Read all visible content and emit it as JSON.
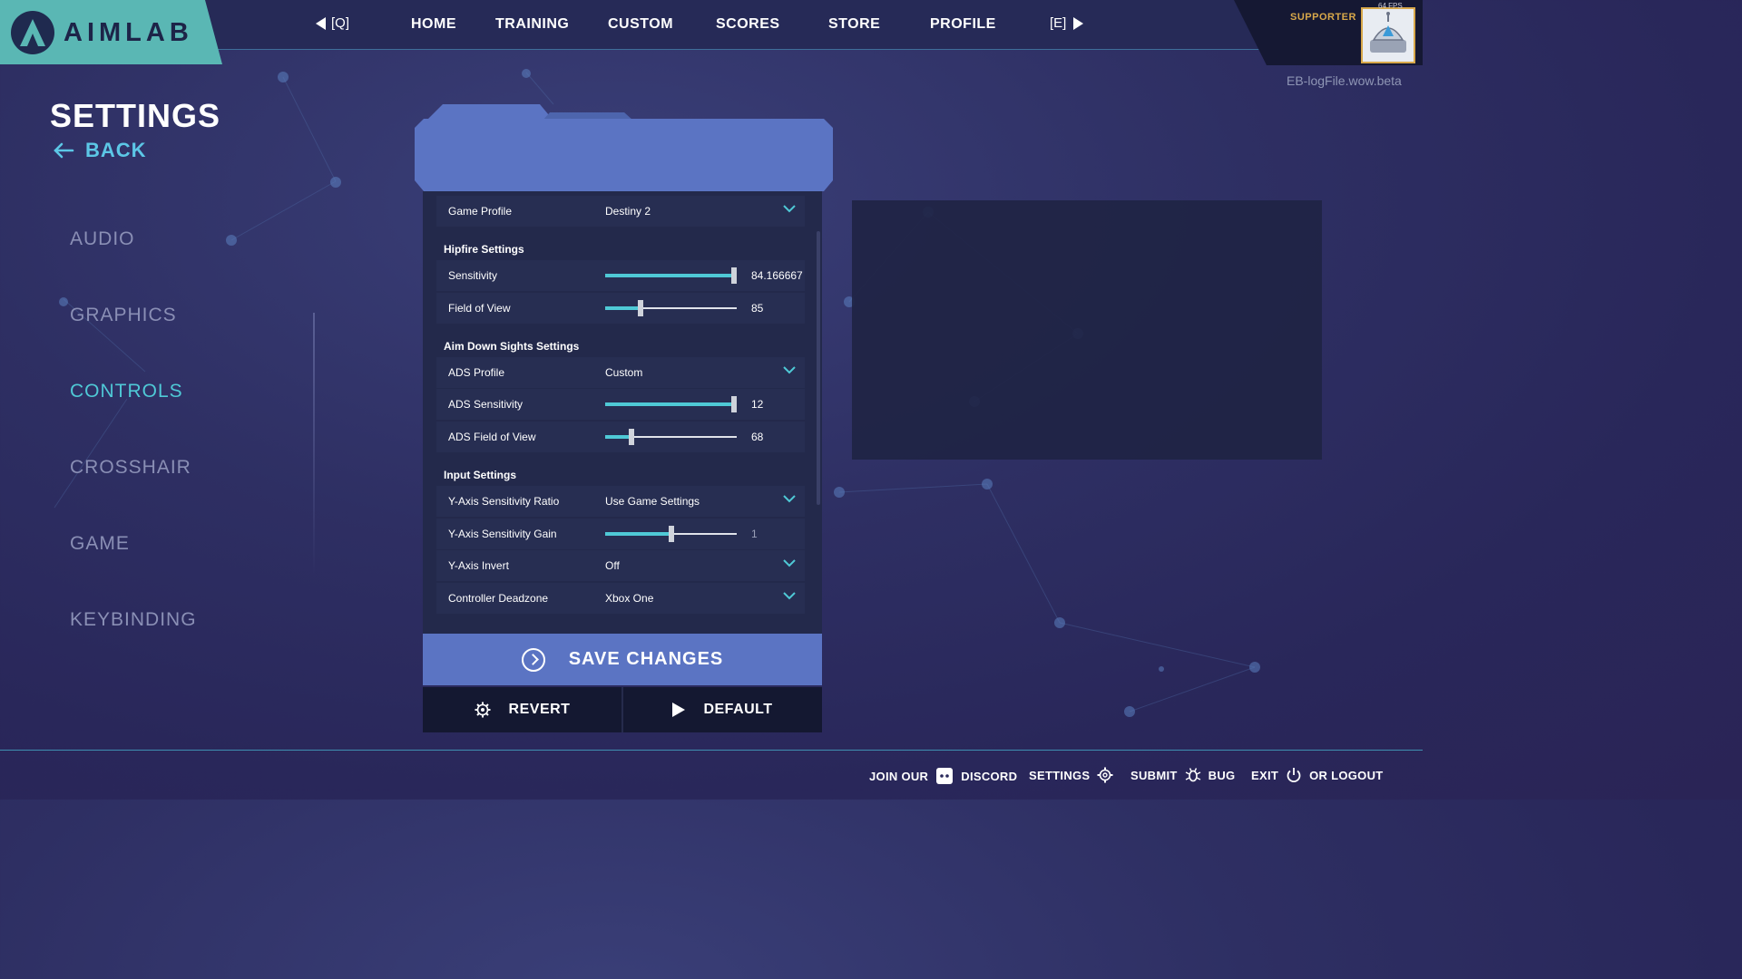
{
  "app": {
    "brand": "AIMLAB"
  },
  "topnav": {
    "prev_key": "[Q]",
    "next_key": "[E]",
    "items": [
      "HOME",
      "TRAINING",
      "CUSTOM",
      "SCORES",
      "STORE",
      "PROFILE"
    ]
  },
  "account": {
    "badge": "SUPPORTER",
    "fps": "64 FPS",
    "log_file": "EB-logFile.wow.beta"
  },
  "settings": {
    "title": "SETTINGS",
    "back": "BACK",
    "categories": [
      "AUDIO",
      "GRAPHICS",
      "CONTROLS",
      "CROSSHAIR",
      "GAME",
      "KEYBINDING"
    ],
    "active_category": "CONTROLS"
  },
  "panel": {
    "game_profile": {
      "label": "Game Profile",
      "value": "Destiny 2"
    },
    "hipfire": {
      "title": "Hipfire Settings",
      "sensitivity": {
        "label": "Sensitivity",
        "value": "84.166667",
        "fraction": 0.98
      },
      "fov": {
        "label": "Field of View",
        "value": "85",
        "fraction": 0.27
      }
    },
    "ads": {
      "title": "Aim Down Sights Settings",
      "profile": {
        "label": "ADS Profile",
        "value": "Custom"
      },
      "sensitivity": {
        "label": "ADS Sensitivity",
        "value": "12",
        "fraction": 0.98
      },
      "fov": {
        "label": "ADS Field of View",
        "value": "68",
        "fraction": 0.2
      }
    },
    "input": {
      "title": "Input Settings",
      "y_ratio": {
        "label": "Y-Axis Sensitivity Ratio",
        "value": "Use Game Settings"
      },
      "y_gain": {
        "label": "Y-Axis Sensitivity Gain",
        "value": "1",
        "fraction": 0.5
      },
      "y_invert": {
        "label": "Y-Axis Invert",
        "value": "Off"
      },
      "deadzone": {
        "label": "Controller Deadzone",
        "value": "Xbox One"
      }
    }
  },
  "actions": {
    "save": "SAVE CHANGES",
    "revert": "REVERT",
    "default": "DEFAULT"
  },
  "footer": {
    "join": "JOIN OUR",
    "discord": "DISCORD",
    "settings": "SETTINGS",
    "submit": "SUBMIT",
    "bug": "BUG",
    "exit": "EXIT",
    "logout": "OR LOGOUT"
  },
  "colors": {
    "accent": "#4fc9d6",
    "panel_blue": "#5b74c3",
    "logo_teal": "#5ab7b4",
    "supporter_gold": "#d8a84a"
  }
}
